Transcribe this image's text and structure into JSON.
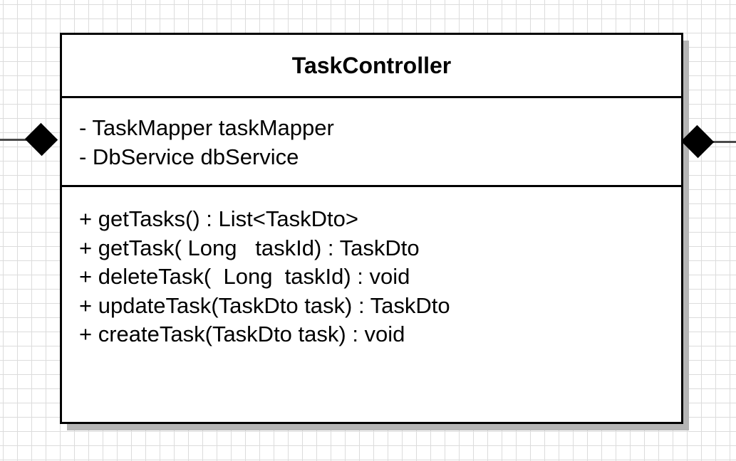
{
  "class": {
    "name": "TaskController",
    "attributes": [
      "- TaskMapper taskMapper",
      "- DbService dbService"
    ],
    "methods": [
      "+ getTasks() : List<TaskDto>",
      "+ getTask( Long   taskId) : TaskDto",
      "+ deleteTask(  Long  taskId) : void",
      "+ updateTask(TaskDto task) : TaskDto",
      "+ createTask(TaskDto task) : void"
    ]
  },
  "connectors": {
    "left": "composition",
    "right": "composition"
  }
}
